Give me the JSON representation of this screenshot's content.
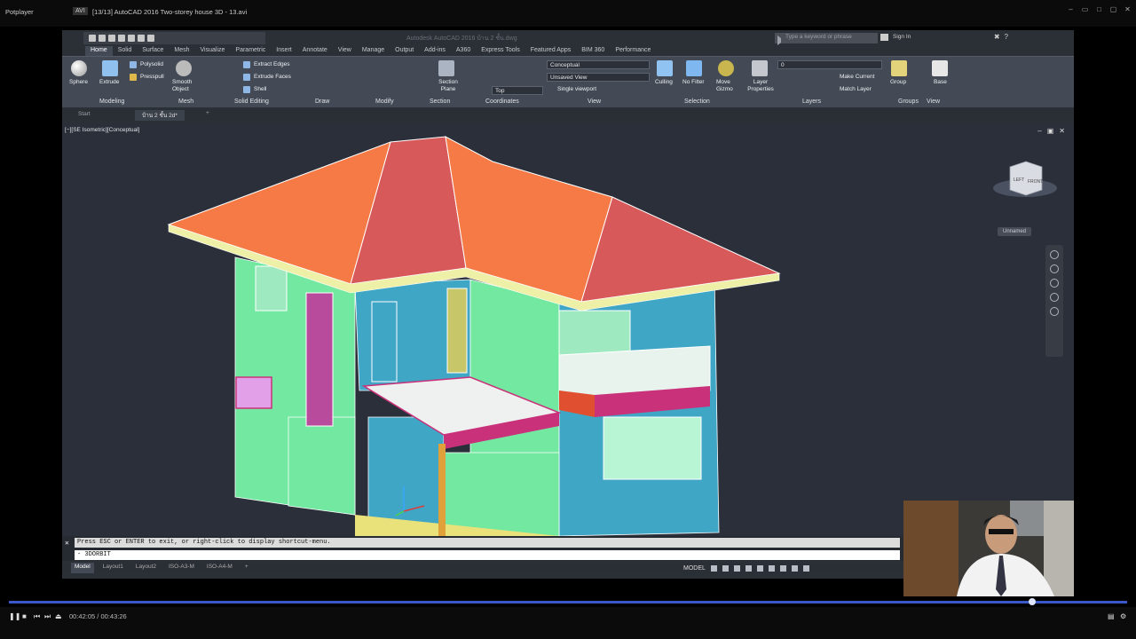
{
  "player": {
    "menu_label": "Potplayer",
    "tag": "AVI",
    "video_title": "[13/13] AutoCAD 2016 Two-storey house 3D - 13.avi",
    "current_time": "00:42:05",
    "total_time": "00:43:26",
    "progress_fraction": 0.915
  },
  "acad": {
    "window_title": "Autodesk AutoCAD 2016  บ้าน 2 ชั้น.dwg",
    "search_placeholder": "Type a keyword or phrase",
    "signin": "Sign In",
    "tabs": [
      "Home",
      "Solid",
      "Surface",
      "Mesh",
      "Visualize",
      "Parametric",
      "Insert",
      "Annotate",
      "View",
      "Manage",
      "Output",
      "Add-ins",
      "A360",
      "Express Tools",
      "Featured Apps",
      "BIM 360",
      "Performance"
    ],
    "active_tab": "Home",
    "ribbon": {
      "modeling": {
        "label": "Modeling",
        "sphere": "Sphere",
        "extrude": "Extrude",
        "polysolid": "Polysolid",
        "presspull": "Presspull"
      },
      "mesh": {
        "label": "Mesh",
        "smooth_object": "Smooth Object"
      },
      "solid_editing": {
        "label": "Solid Editing",
        "extract_edges": "Extract Edges",
        "extrude_faces": "Extrude Faces",
        "shell": "Shell"
      },
      "draw": {
        "label": "Draw"
      },
      "modify": {
        "label": "Modify"
      },
      "section": {
        "label": "Section",
        "section_plane": "Section Plane"
      },
      "coordinates": {
        "label": "Coordinates",
        "view_name": "Top"
      },
      "view": {
        "label": "View",
        "visual_style": "Conceptual",
        "saved_view": "Unsaved View",
        "viewport": "Single viewport"
      },
      "selection": {
        "label": "Selection",
        "culling": "Culling",
        "no_filter": "No Filter",
        "move_gizmo": "Move Gizmo"
      },
      "layers": {
        "label": "Layers",
        "layer_properties": "Layer Properties",
        "current_layer": "0",
        "make_current": "Make Current",
        "match_layer": "Match Layer"
      },
      "groups": {
        "label": "Groups",
        "group": "Group"
      },
      "view2": {
        "label": "View",
        "base": "Base"
      }
    },
    "doc_tabs": [
      "Start",
      "บ้าน 2 ชั้น 2d*"
    ],
    "viewport_label": "[−][SE Isometric][Conceptual]",
    "viewcube": {
      "left": "LEFT",
      "front": "FRONT",
      "unnamed": "Unnamed"
    },
    "command": {
      "line1": "Press ESC or ENTER to exit, or right-click to display shortcut-menu.",
      "line2": "3DORBIT",
      "prompt": "-"
    },
    "layout_tabs": [
      "Model",
      "Layout1",
      "Layout2",
      "ISO-A3-M",
      "ISO-A4-M"
    ],
    "status_model": "MODEL"
  },
  "colors": {
    "roof_light": "#f57a45",
    "roof_dark": "#d7595a",
    "wall": "#72e8a0",
    "wall_blue": "#3fa6c6",
    "trim": "#e9ed9a",
    "accent": "#c9327a",
    "seek": "#3b57c8"
  }
}
